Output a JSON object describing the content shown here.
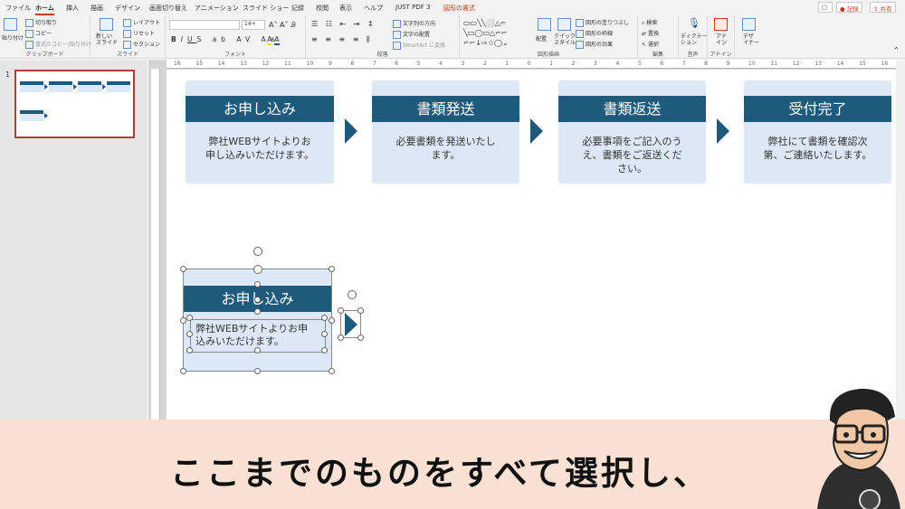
{
  "tabs": [
    "ファイル",
    "ホーム",
    "挿入",
    "描画",
    "デザイン",
    "画面切り替え",
    "アニメーション",
    "スライド ショー",
    "記録",
    "校閲",
    "表示",
    "ヘルプ",
    "JUST PDF 3",
    "図形の書式"
  ],
  "title_buttons": {
    "share": "共有",
    "record": "記録"
  },
  "ribbon": {
    "clipboard": {
      "paste": "貼り付け",
      "cut": "切り取り",
      "copy": "コピー",
      "format_painter": "書式のコピー/貼り付け",
      "label": "クリップボード"
    },
    "slides": {
      "new_slide": "新しい\nスライド",
      "layout": "レイアウト",
      "reset": "リセット",
      "section": "セクション",
      "label": "スライド"
    },
    "font": {
      "size": "14+",
      "label": "フォント"
    },
    "paragraph": {
      "text_direction": "文字列の方向",
      "align_text": "文字の配置",
      "smartart": "SmartArt に変換",
      "label": "段落"
    },
    "drawing": {
      "arrange": "配置",
      "quick_styles": "クイック\nスタイル",
      "fill": "図形の塗りつぶし",
      "outline": "図形の枠線",
      "effects": "図形の効果",
      "label": "図形描画"
    },
    "editing": {
      "find": "検索",
      "replace": "置換",
      "select": "選択",
      "label": "編集"
    },
    "voice": {
      "dictate": "ディクテー\nション",
      "label": "音声"
    },
    "addins": {
      "addins": "アド\nイン",
      "label": "アドイン"
    },
    "designer": {
      "designer": "デザ\nイナー"
    }
  },
  "thumb_number": "1",
  "ruler_labels": [
    "16",
    "15",
    "14",
    "13",
    "12",
    "11",
    "10",
    "9",
    "8",
    "7",
    "6",
    "5",
    "4",
    "3",
    "2",
    "1",
    "0",
    "1",
    "2",
    "3",
    "4",
    "5",
    "6",
    "7",
    "8",
    "9",
    "10",
    "11",
    "12",
    "13",
    "14",
    "15",
    "16"
  ],
  "steps": [
    {
      "title": "お申し込み",
      "body": "弊社WEBサイトよりお\n申し込みいただけます。"
    },
    {
      "title": "書類発送",
      "body": "必要書類を発送いたし\nます。"
    },
    {
      "title": "書類返送",
      "body": "必要事項をご記入のう\nえ、書類をご返送くだ\nさい。"
    },
    {
      "title": "受付完了",
      "body": "弊社にて書類を確認次\n第、ご連絡いたします。"
    }
  ],
  "selected_card": {
    "title": "お申し込み",
    "body": "弊社WEBサイトよりお申\n込みいただけます。"
  },
  "caption": "ここまでのものをすべて選択し、",
  "colors": {
    "accent": "#1d5a7b",
    "card_bg": "#dce8f5",
    "caption_bg": "#fbe1d3",
    "tab_context": "#c43e1c"
  }
}
